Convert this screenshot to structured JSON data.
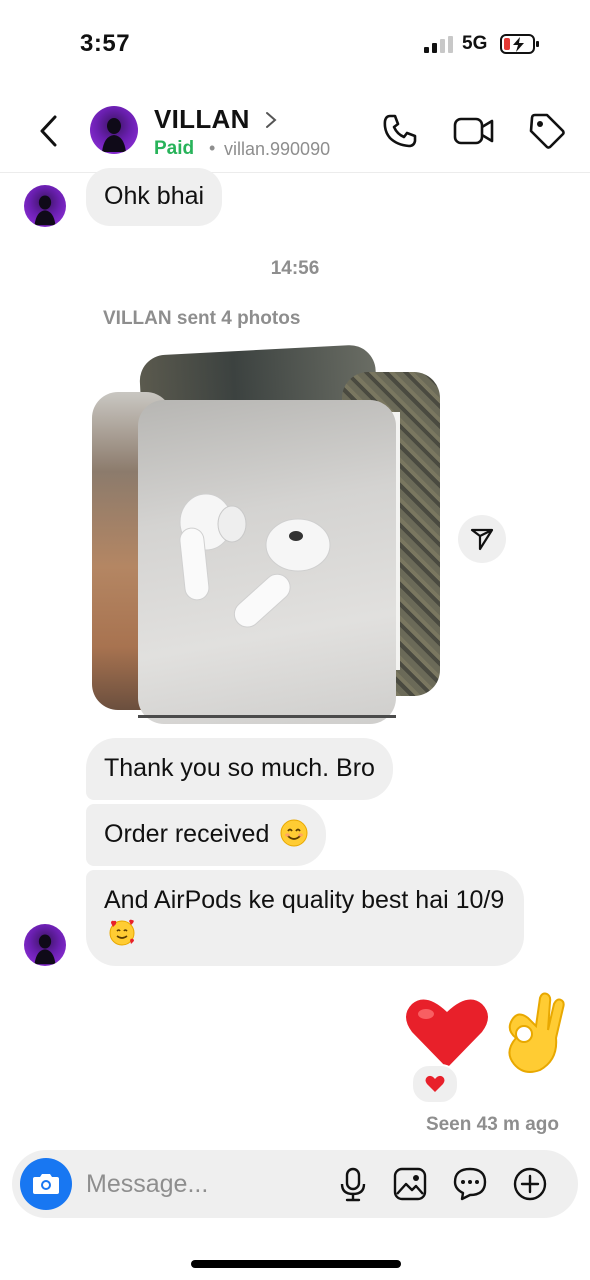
{
  "status_bar": {
    "time": "3:57",
    "network": "5G",
    "signal_icon": "cell-signal-icon",
    "battery_icon": "battery-charging-icon",
    "battery_color": "#e53935"
  },
  "header": {
    "name": "VILLAN",
    "badge": "Paid",
    "separator": "•",
    "username": "villan.990090",
    "badge_color": "#28b35a"
  },
  "messages": {
    "first": "Ohk bhai",
    "timestamp": "14:56",
    "photos_note": "VILLAN sent 4 photos",
    "thanks": "Thank you so much. Bro",
    "order": "Order received",
    "quality": "And AirPods ke quality  best hai 10/9"
  },
  "reactions": {
    "seen": "Seen 43 m ago",
    "heart_color": "#e8202a"
  },
  "composer": {
    "placeholder": "Message...",
    "accent": "#1877f2"
  }
}
